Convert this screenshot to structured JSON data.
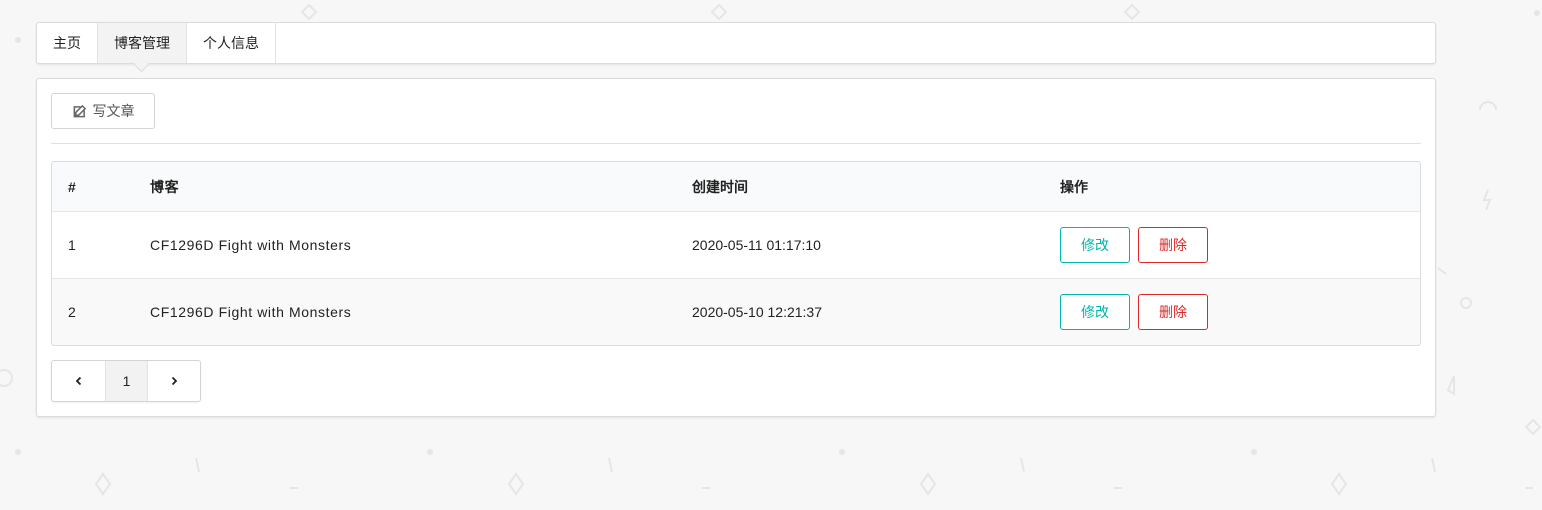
{
  "tabs": [
    {
      "label": "主页",
      "active": false
    },
    {
      "label": "博客管理",
      "active": true
    },
    {
      "label": "个人信息",
      "active": false
    }
  ],
  "toolbar": {
    "write_label": "写文章",
    "write_icon": "edit-icon"
  },
  "table": {
    "headers": [
      "#",
      "博客",
      "创建时间",
      "操作"
    ],
    "rows": [
      {
        "index": "1",
        "title": "CF1296D Fight with Monsters",
        "created": "2020-05-11 01:17:10",
        "edit": "修改",
        "delete": "删除"
      },
      {
        "index": "2",
        "title": "CF1296D Fight with Monsters",
        "created": "2020-05-10 12:21:37",
        "edit": "修改",
        "delete": "删除"
      }
    ]
  },
  "pagination": {
    "prev_icon": "chevron-left-icon",
    "current_page": "1",
    "next_icon": "chevron-right-icon"
  },
  "colors": {
    "edit": "#00b5ad",
    "delete": "#db2828",
    "background": "#f7f7f7"
  }
}
